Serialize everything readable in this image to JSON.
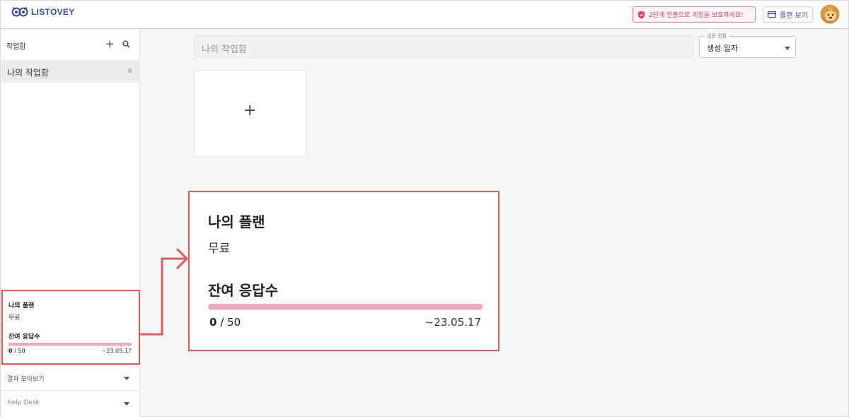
{
  "header": {
    "logo_text": "LISTOVEY",
    "twofa_text": "2단계 인증으로 계정을 보호하세요!",
    "plan_button_label": "플랜 보기"
  },
  "sidebar": {
    "title": "작업함",
    "items": [
      {
        "label": "나의 작업함",
        "count": "0"
      }
    ],
    "plan_card": {
      "title": "나의 플랜",
      "plan_name": "무료",
      "remaining_label": "잔여 응답수",
      "used": "0",
      "limit": " / 50",
      "usage_fraction": 0,
      "expiry": "~23.05.17"
    },
    "rows": [
      {
        "label": "결과 모아보기"
      },
      {
        "label": "Help Desk"
      }
    ]
  },
  "main": {
    "search_placeholder": "나의 작업함",
    "sort": {
      "label": "설문 정렬",
      "value": "생성 일자"
    },
    "add_card_symbol": "+"
  },
  "zoom_callout": {
    "title": "나의 플랜",
    "plan_name": "무료",
    "remaining_label": "잔여 응답수",
    "used": "0",
    "limit": " / 50",
    "expiry": "~23.05.17"
  },
  "colors": {
    "brand": "#3b4ba3",
    "alert": "#e0406b",
    "callout_border": "#e85a5a",
    "usage_bar": "#f4a4bd"
  }
}
